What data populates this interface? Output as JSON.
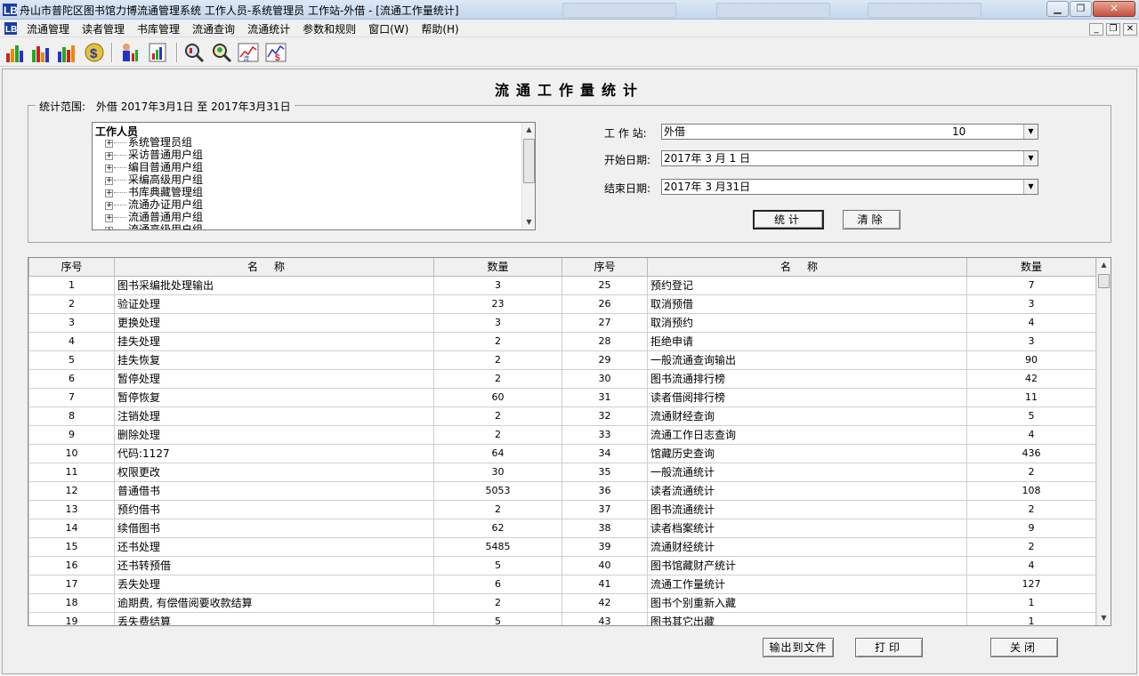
{
  "window": {
    "title": "舟山市普陀区图书馆力博流通管理系统 工作人员-系统管理员 工作站-外借 - [流通工作量统计]"
  },
  "menu": [
    {
      "label": "流通管理"
    },
    {
      "label": "读者管理"
    },
    {
      "label": "书库管理"
    },
    {
      "label": "流通查询"
    },
    {
      "label": "流通统计"
    },
    {
      "label": "参数和规则"
    },
    {
      "label": "窗口(W)"
    },
    {
      "label": "帮助(H)"
    }
  ],
  "form": {
    "title": "流通工作量统计",
    "scope_label": "统计范围:",
    "scope_value": "外借 2017年3月1日 至 2017年3月31日"
  },
  "tree": {
    "root": "工作人员",
    "items": [
      "系统管理员组",
      "采访普通用户组",
      "编目普通用户组",
      "采编高级用户组",
      "书库典藏管理组",
      "流通办证用户组",
      "流通普通用户组",
      "流通高级用户组"
    ]
  },
  "fields": {
    "workstation_label": "工 作 站:",
    "workstation_value": "外借",
    "workstation_code": "10",
    "start_label": "开始日期:",
    "start_value": "2017年 3 月 1 日",
    "end_label": "结束日期:",
    "end_value": "2017年 3 月31日"
  },
  "buttons": {
    "stat": "统计",
    "clear": "清除",
    "export": "输出到文件",
    "print": "打印",
    "close": "关闭"
  },
  "table": {
    "headers": [
      "序号",
      "名称",
      "数量",
      "序号",
      "名称",
      "数量"
    ],
    "rows": [
      [
        [
          "1",
          "图书采编批处理输出",
          "3"
        ],
        [
          "25",
          "预约登记",
          "7"
        ]
      ],
      [
        [
          "2",
          "验证处理",
          "23"
        ],
        [
          "26",
          "取消预借",
          "3"
        ]
      ],
      [
        [
          "3",
          "更换处理",
          "3"
        ],
        [
          "27",
          "取消预约",
          "4"
        ]
      ],
      [
        [
          "4",
          "挂失处理",
          "2"
        ],
        [
          "28",
          "拒绝申请",
          "3"
        ]
      ],
      [
        [
          "5",
          "挂失恢复",
          "2"
        ],
        [
          "29",
          "一般流通查询输出",
          "90"
        ]
      ],
      [
        [
          "6",
          "暂停处理",
          "2"
        ],
        [
          "30",
          "图书流通排行榜",
          "42"
        ]
      ],
      [
        [
          "7",
          "暂停恢复",
          "60"
        ],
        [
          "31",
          "读者借阅排行榜",
          "11"
        ]
      ],
      [
        [
          "8",
          "注销处理",
          "2"
        ],
        [
          "32",
          "流通财经查询",
          "5"
        ]
      ],
      [
        [
          "9",
          "删除处理",
          "2"
        ],
        [
          "33",
          "流通工作日志查询",
          "4"
        ]
      ],
      [
        [
          "10",
          "代码:1127",
          "64"
        ],
        [
          "34",
          "馆藏历史查询",
          "436"
        ]
      ],
      [
        [
          "11",
          "权限更改",
          "30"
        ],
        [
          "35",
          "一般流通统计",
          "2"
        ]
      ],
      [
        [
          "12",
          "普通借书",
          "5053"
        ],
        [
          "36",
          "读者流通统计",
          "108"
        ]
      ],
      [
        [
          "13",
          "预约借书",
          "2"
        ],
        [
          "37",
          "图书流通统计",
          "2"
        ]
      ],
      [
        [
          "14",
          "续借图书",
          "62"
        ],
        [
          "38",
          "读者档案统计",
          "9"
        ]
      ],
      [
        [
          "15",
          "还书处理",
          "5485"
        ],
        [
          "39",
          "流通财经统计",
          "2"
        ]
      ],
      [
        [
          "16",
          "还书转预借",
          "5"
        ],
        [
          "40",
          "图书馆藏财产统计",
          "4"
        ]
      ],
      [
        [
          "17",
          "丢失处理",
          "6"
        ],
        [
          "41",
          "流通工作量统计",
          "127"
        ]
      ],
      [
        [
          "18",
          "逾期费, 有偿借阅要收款结算",
          "2"
        ],
        [
          "42",
          "图书个别重新入藏",
          "1"
        ]
      ],
      [
        [
          "19",
          "丢失费结算",
          "5"
        ],
        [
          "43",
          "图书其它出藏",
          "1"
        ]
      ]
    ]
  }
}
